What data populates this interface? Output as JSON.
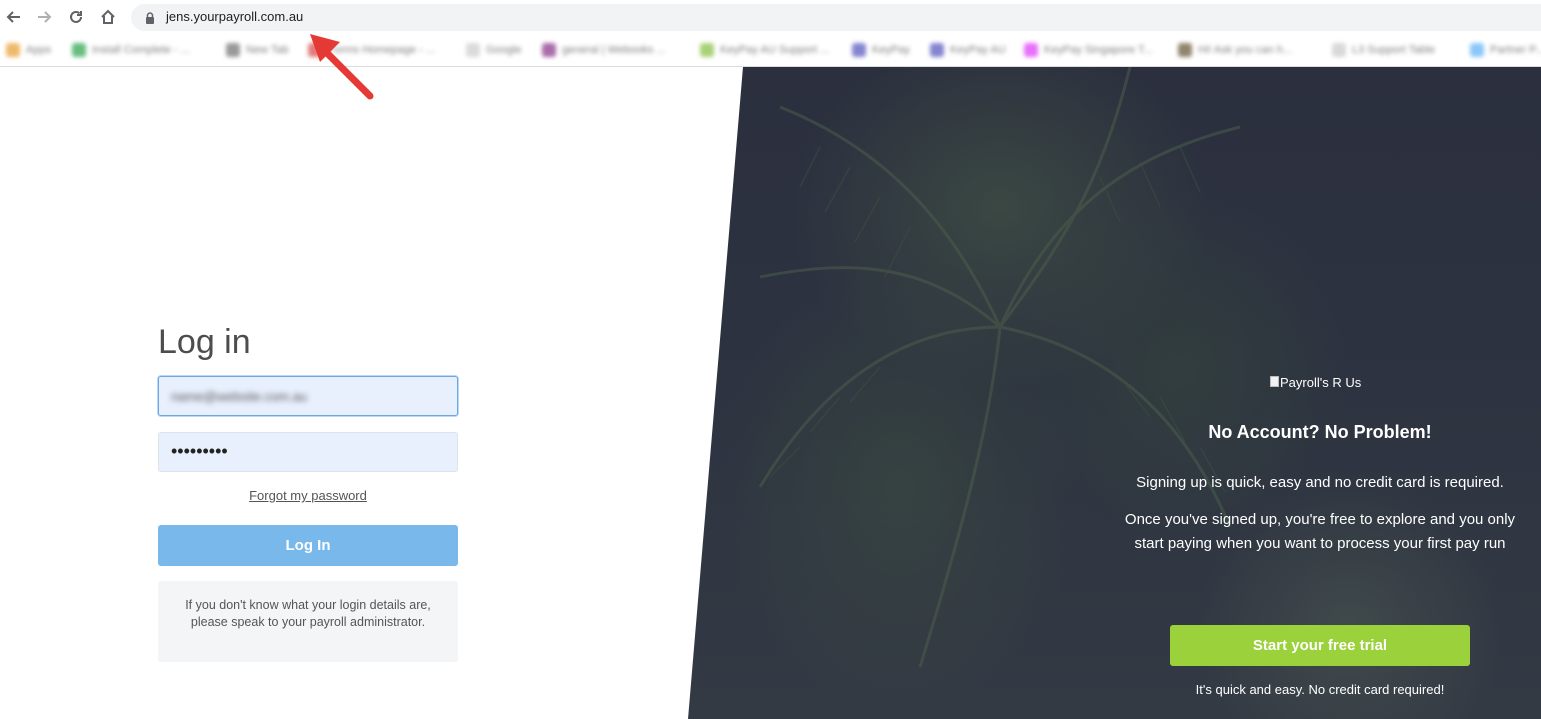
{
  "browser": {
    "url": "jens.yourpayroll.com.au",
    "bookmarks": [
      {
        "label": "Apps",
        "color": "#e8a23a"
      },
      {
        "label": "Install Complete - ...",
        "color": "#34a853"
      },
      {
        "label": "New Tab",
        "color": "#777777"
      },
      {
        "label": "Forms Homepage - ...",
        "color": "#d94f4f"
      },
      {
        "label": "Google",
        "color": "#cfcfcf"
      },
      {
        "label": "general | Webooks ...",
        "color": "#8e3c8e"
      },
      {
        "label": "KeyPay AU Support ...",
        "color": "#8bc34a"
      },
      {
        "label": "KeyPay",
        "color": "#5c5cc2"
      },
      {
        "label": "KeyPay AU",
        "color": "#5c5cc2"
      },
      {
        "label": "KeyPay Singapore T...",
        "color": "#e040fb"
      },
      {
        "label": "Hi! Ask you can h...",
        "color": "#6d5c3d"
      },
      {
        "label": "L3 Support Table",
        "color": "#cccccc"
      },
      {
        "label": "Partner P...",
        "color": "#64b5f6"
      }
    ]
  },
  "login": {
    "title": "Log in",
    "email_value": "name@website.com.au",
    "password_dots": "•••••••••",
    "forgot_label": "Forgot my password",
    "button_label": "Log In",
    "help_text": "If you don't know what your login details are, please speak to your payroll administrator."
  },
  "promo": {
    "logo_alt": "Payroll's R Us",
    "heading": "No Account? No Problem!",
    "p1": "Signing up is quick, easy and no credit card is required.",
    "p2": "Once you've signed up, you're free to explore and you only start paying when you want to process your first pay run",
    "button_label": "Start your free trial",
    "footnote": "It's quick and easy. No credit card required!"
  },
  "colors": {
    "login_button": "#79b8ea",
    "trial_button": "#9bd13b",
    "annotation_arrow": "#e53935"
  }
}
